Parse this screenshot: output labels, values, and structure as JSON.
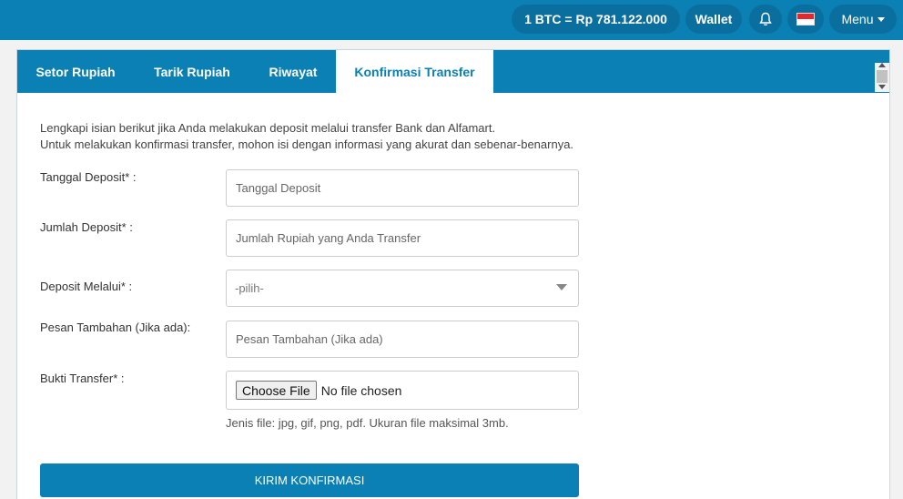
{
  "topbar": {
    "rate": "1 BTC = Rp 781.122.000",
    "wallet": "Wallet",
    "menu": "Menu",
    "bell_icon": "bell-icon",
    "flag_icon": "indonesia-flag-icon"
  },
  "tabs": [
    {
      "label": "Setor Rupiah"
    },
    {
      "label": "Tarik Rupiah"
    },
    {
      "label": "Riwayat"
    },
    {
      "label": "Konfirmasi Transfer",
      "active": true
    }
  ],
  "intro": {
    "line1": "Lengkapi isian berikut jika Anda melakukan deposit melalui transfer Bank dan Alfamart.",
    "line2": "Untuk melakukan konfirmasi transfer, mohon isi dengan informasi yang akurat dan sebenar-benarnya."
  },
  "form": {
    "tanggal": {
      "label": "Tanggal Deposit* :",
      "placeholder": "Tanggal Deposit"
    },
    "jumlah": {
      "label": "Jumlah Deposit* :",
      "placeholder": "Jumlah Rupiah yang Anda Transfer"
    },
    "melalui": {
      "label": "Deposit Melalui* :",
      "selected": "-pilih-"
    },
    "pesan": {
      "label": "Pesan Tambahan (Jika ada):",
      "placeholder": "Pesan Tambahan (Jika ada)"
    },
    "bukti": {
      "label": "Bukti Transfer* :",
      "button": "Choose File",
      "status": "No file chosen"
    },
    "hint": "Jenis file: jpg, gif, png, pdf. Ukuran file maksimal 3mb.",
    "submit": "KIRIM KONFIRMASI"
  },
  "colors": {
    "primary": "#0a80b5",
    "topbar_pill": "#0a6f9e"
  }
}
